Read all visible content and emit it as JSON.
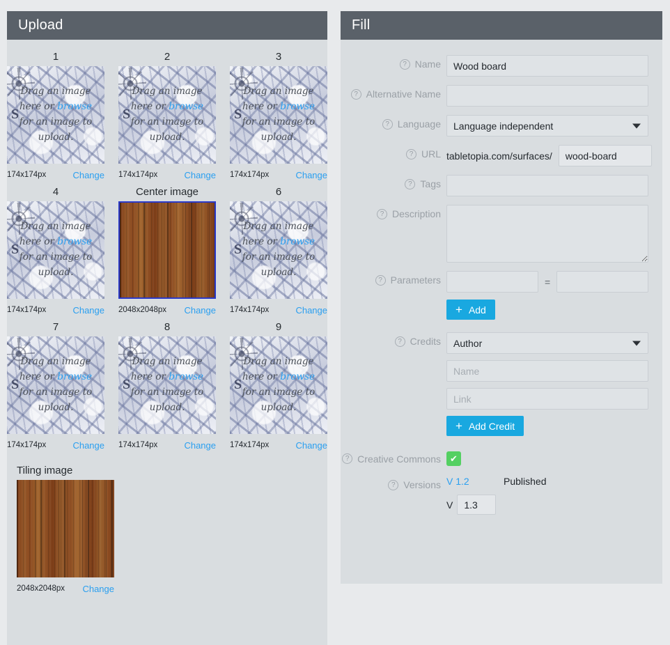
{
  "upload": {
    "header_title": "Upload",
    "placeholder_text_before": "Drag an image here or ",
    "placeholder_browse": "browse",
    "placeholder_text_after": " for an image to upload.",
    "rose_letter": "S",
    "change_label": "Change",
    "thumbs": [
      {
        "title": "1",
        "size": "174x174px",
        "kind": "placeholder"
      },
      {
        "title": "2",
        "size": "174x174px",
        "kind": "placeholder"
      },
      {
        "title": "3",
        "size": "174x174px",
        "kind": "placeholder"
      },
      {
        "title": "4",
        "size": "174x174px",
        "kind": "placeholder"
      },
      {
        "title": "Center image",
        "size": "2048x2048px",
        "kind": "wood-selected"
      },
      {
        "title": "6",
        "size": "174x174px",
        "kind": "placeholder"
      },
      {
        "title": "7",
        "size": "174x174px",
        "kind": "placeholder"
      },
      {
        "title": "8",
        "size": "174x174px",
        "kind": "placeholder"
      },
      {
        "title": "9",
        "size": "174x174px",
        "kind": "placeholder"
      }
    ],
    "tiling": {
      "title": "Tiling image",
      "size": "2048x2048px",
      "change_label": "Change"
    }
  },
  "fill": {
    "header_title": "Fill",
    "help_glyph": "?",
    "labels": {
      "name": "Name",
      "alternative_name": "Alternative Name",
      "language": "Language",
      "url": "URL",
      "tags": "Tags",
      "description": "Description",
      "parameters": "Parameters",
      "credits": "Credits",
      "creative_commons": "Creative Commons",
      "versions": "Versions"
    },
    "values": {
      "name": "Wood board",
      "alternative_name": "",
      "language": "Language independent",
      "url_prefix": "tabletopia.com/surfaces/",
      "url_slug": "wood-board",
      "tags": "",
      "description": "",
      "parameter_key": "",
      "parameter_value": "",
      "parameter_equals": "=",
      "credits_type": "Author",
      "credit_name": "",
      "credit_link": "",
      "creative_commons_checked": true,
      "check_glyph": "✔",
      "version_published_label": "V 1.2",
      "version_published_status": "Published",
      "version_new_prefix": "V",
      "version_new_value": "1.3"
    },
    "placeholders": {
      "credit_name": "Name",
      "credit_link": "Link"
    },
    "buttons": {
      "add_parameter": "Add",
      "add_credit": "Add Credit",
      "plus_glyph": "+"
    }
  },
  "colors": {
    "header_bar": "#5a6169",
    "panel_bg": "#d9dde0",
    "page_bg": "#e8eaec",
    "accent_blue": "#19a8e0",
    "link_blue": "#2a9ff0",
    "check_green": "#54d062",
    "selected_border": "#2a39c8"
  }
}
